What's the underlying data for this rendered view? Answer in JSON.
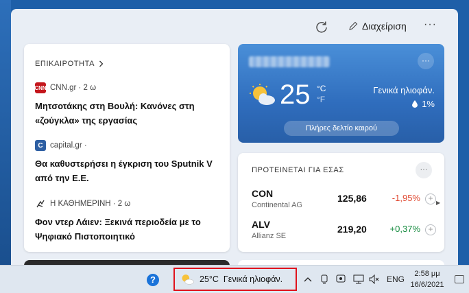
{
  "topbar": {
    "manage_label": "Διαχείριση",
    "more_label": "···"
  },
  "news": {
    "section_label": "ΕΠΙΚΑΙΡΟΤΗΤΑ",
    "articles": [
      {
        "source": "CNN.gr · 2 ω",
        "logo_text": "CNN",
        "headline": "Μητσοτάκης στη Βουλή: Κανόνες στη «ζούγκλα» της εργασίας"
      },
      {
        "source": "capital.gr ·",
        "logo_text": "C",
        "headline": "Θα καθυστερήσει η έγκριση του Sputnik V από την Ε.Ε."
      },
      {
        "source": "Η ΚΑΘΗΜΕΡΙΝΗ · 2 ω",
        "logo_text": "",
        "headline": "Φον ντερ Λάιεν: Ξεκινά περιοδεία με το Ψηφιακό Πιστοποιητικό"
      }
    ]
  },
  "weather": {
    "temperature": "25",
    "unit_c": "°C",
    "unit_f": "°F",
    "condition": "Γενικά ηλιοφάν.",
    "precip": "1%",
    "full_forecast": "Πλήρες δελτίο καιρού",
    "more_label": "···"
  },
  "stocks": {
    "section_label": "ΠΡΟΤΕΙΝΕΤΑΙ ΓΙΑ ΕΣΑΣ",
    "more_label": "···",
    "items": [
      {
        "symbol": "CON",
        "name": "Continental AG",
        "price": "125,86",
        "change": "-1,95%",
        "trend": "down"
      },
      {
        "symbol": "ALV",
        "name": "Allianz SE",
        "price": "219,20",
        "change": "+0,37%",
        "trend": "up"
      }
    ]
  },
  "taskbar": {
    "help": "?",
    "weather_text": "25°C  Γενικά ηλιοφάν.",
    "language": "ENG",
    "time": "2:58 μμ",
    "date": "16/6/2021"
  },
  "colors": {
    "down": "#e0462e",
    "up": "#138a3d",
    "highlight": "#e0121c",
    "accent": "#2f6dbd"
  }
}
